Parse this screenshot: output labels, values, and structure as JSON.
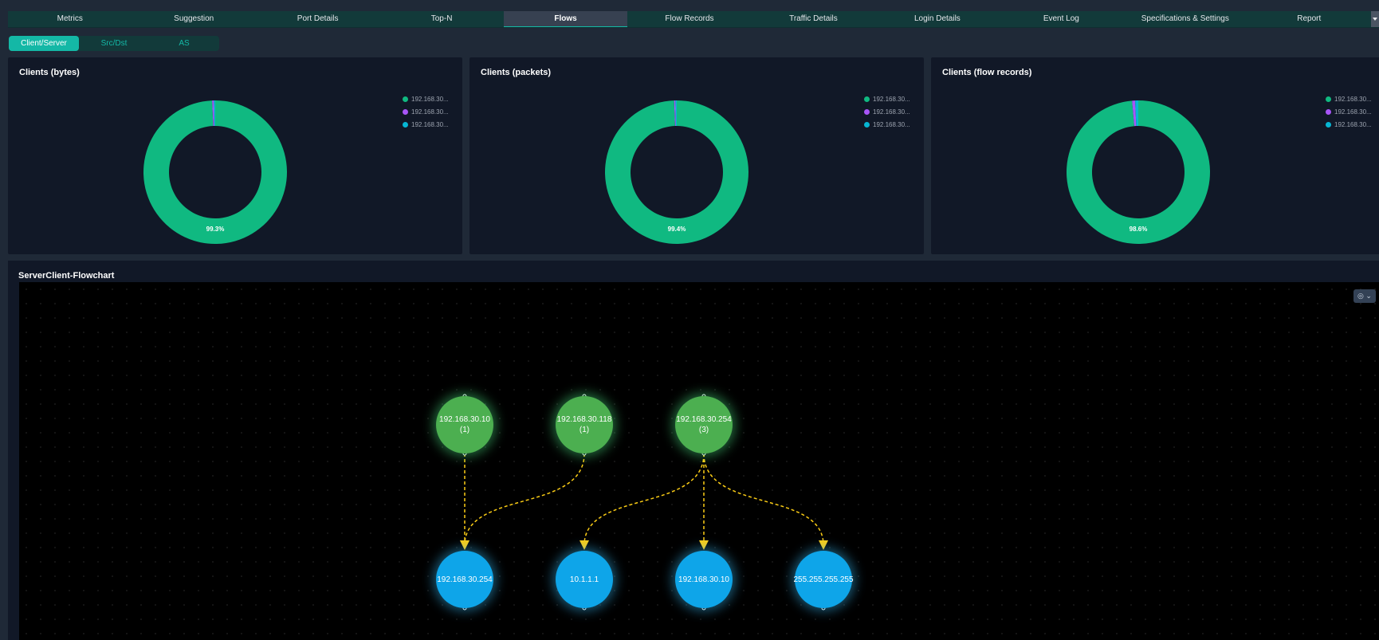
{
  "tabs": [
    {
      "label": "Metrics"
    },
    {
      "label": "Suggestion"
    },
    {
      "label": "Port Details"
    },
    {
      "label": "Top-N"
    },
    {
      "label": "Flows",
      "active": true
    },
    {
      "label": "Flow Records"
    },
    {
      "label": "Traffic Details"
    },
    {
      "label": "Login Details"
    },
    {
      "label": "Event Log"
    },
    {
      "label": "Specifications & Settings"
    },
    {
      "label": "Report"
    }
  ],
  "subtabs": [
    {
      "label": "Client/Server",
      "active": true
    },
    {
      "label": "Src/Dst"
    },
    {
      "label": "AS"
    }
  ],
  "panels": [
    {
      "title": "Clients (bytes)",
      "pct_label": "99.3%"
    },
    {
      "title": "Clients (packets)",
      "pct_label": "99.4%"
    },
    {
      "title": "Clients (flow records)",
      "pct_label": "98.6%"
    }
  ],
  "colors": {
    "green": "#10b981",
    "purple": "#a855f7",
    "cyan": "#06b6d4",
    "edge": "#facc15"
  },
  "chart_data": [
    {
      "type": "pie",
      "title": "Clients (bytes)",
      "categories": [
        "192.168.30...",
        "192.168.30...",
        "192.168.30..."
      ],
      "values": [
        99.3,
        0.4,
        0.3
      ],
      "legend": "right"
    },
    {
      "type": "pie",
      "title": "Clients (packets)",
      "categories": [
        "192.168.30...",
        "192.168.30...",
        "192.168.30..."
      ],
      "values": [
        99.4,
        0.3,
        0.3
      ],
      "legend": "right"
    },
    {
      "type": "pie",
      "title": "Clients (flow records)",
      "categories": [
        "192.168.30...",
        "192.168.30...",
        "192.168.30..."
      ],
      "values": [
        98.6,
        0.7,
        0.7
      ],
      "legend": "right"
    }
  ],
  "flowchart": {
    "title": "ServerClient-Flowchart",
    "camera_icon": "camera-icon",
    "servers": [
      {
        "ip": "192.168.30.10",
        "count": "(1)"
      },
      {
        "ip": "192.168.30.118",
        "count": "(1)"
      },
      {
        "ip": "192.168.30.254",
        "count": "(3)"
      }
    ],
    "clients": [
      {
        "ip": "192.168.30.254"
      },
      {
        "ip": "10.1.1.1"
      },
      {
        "ip": "192.168.30.10"
      },
      {
        "ip": "255.255.255.255"
      }
    ]
  }
}
